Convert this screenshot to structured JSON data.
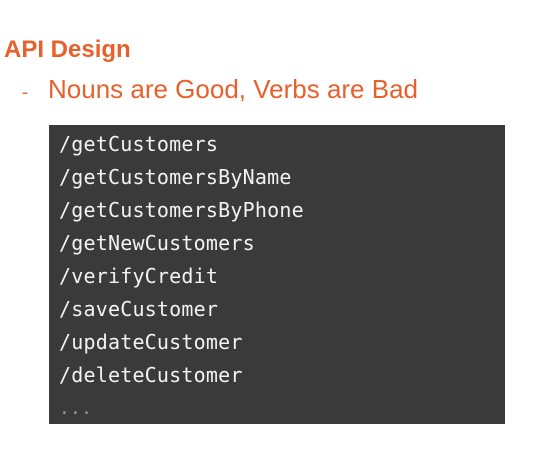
{
  "slide": {
    "title": "API Design",
    "bullet_marker": "-",
    "bullet_text": "Nouns are Good, Verbs are Bad"
  },
  "code": {
    "lines": [
      "/getCustomers",
      "/getCustomersByName",
      "/getCustomersByPhone",
      "/getNewCustomers",
      "/verifyCredit",
      "/saveCustomer",
      "/updateCustomer",
      "/deleteCustomer",
      "..."
    ]
  },
  "colors": {
    "accent": "#e8602c",
    "code_background": "#3a3a3a",
    "code_text": "#f2f2f2"
  }
}
